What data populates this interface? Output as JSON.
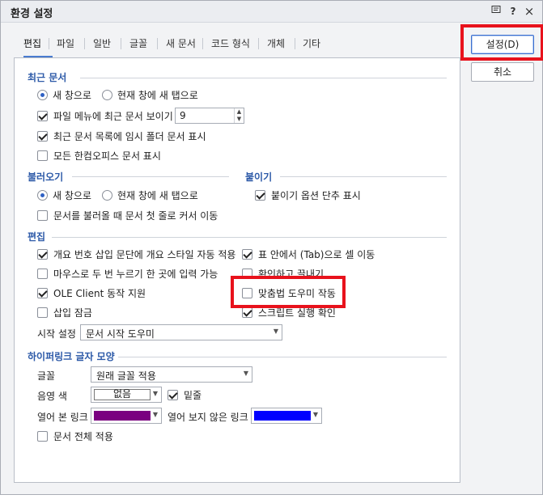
{
  "window": {
    "title": "환경 설정"
  },
  "titlebar_icons": {
    "memo": "memo-icon",
    "help": "?",
    "close": "×"
  },
  "tabs": [
    "편집",
    "파일",
    "일반",
    "글꼴",
    "새 문서",
    "코드 형식",
    "개체",
    "기타"
  ],
  "buttons": {
    "ok": "설정(D)",
    "cancel": "취소"
  },
  "recent": {
    "title": "최근 문서",
    "radio_new_window": "새 창으로",
    "radio_new_tab": "현재 창에 새 탭으로",
    "show_in_file_menu": "파일 메뉴에 최근 문서 보이기",
    "count": "9",
    "temp_folder": "최근 문서 목록에 임시 폴더 문서 표시",
    "all_hancom": "모든 한컴오피스 문서 표시"
  },
  "open": {
    "title": "불러오기",
    "radio_new_window": "새 창으로",
    "radio_new_tab": "현재 창에 새 탭으로",
    "cursor_first_line": "문서를 불러올 때 문서 첫 줄로 커서 이동"
  },
  "paste": {
    "title": "붙이기",
    "show_options": "붙이기 옵션 단추 표시"
  },
  "edit": {
    "title": "편집",
    "outline_style": "개요 번호 삽입 문단에 개요 스타일 자동 적용",
    "tab_cell_move": "표 안에서 (Tab)으로 셀 이동",
    "double_click_input": "마우스로 두 번 누르기 한 곳에 입력 가능",
    "confirm_unload": "확인하고 끌내기",
    "ole_client": "OLE Client 동작 지원",
    "spell_helper": "맞춤법 도우미 작동",
    "insert_lock": "삽입 잠금",
    "script_confirm": "스크립트 실행 확인",
    "start_setting_label": "시작 설정",
    "start_setting_value": "문서 시작 도우미"
  },
  "hyperlink": {
    "title": "하이퍼링크 글자 모양",
    "font_label": "글꼴",
    "font_value": "원래 글꼴 적용",
    "shade_label": "음영 색",
    "shade_value": "없음",
    "underline": "밑줄",
    "visited_label": "열어 본 링크",
    "unvisited_label": "열어 보지 않은 링크",
    "apply_all": "문서 전체 적용"
  },
  "colors": {
    "visited": "#7a0080",
    "unvisited": "#0000ff",
    "accent": "#2d5aa8",
    "highlight": "#e8121c"
  }
}
